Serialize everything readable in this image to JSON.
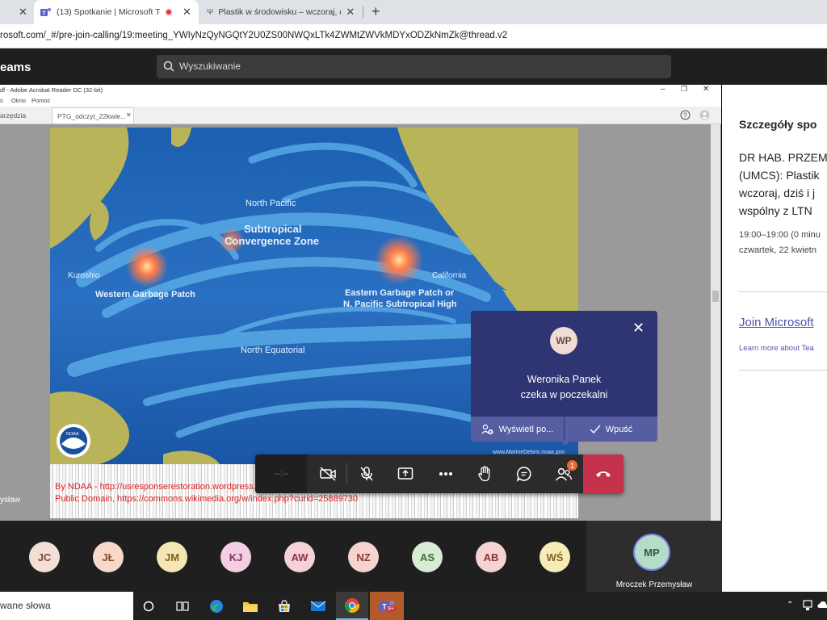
{
  "browser": {
    "tabs": [
      {
        "label": "(13) Spotkanie | Microsoft Te"
      },
      {
        "label": "Plastik w środowisku – wczoraj, d"
      }
    ],
    "address": "rosoft.com/_#/pre-join-calling/19:meeting_YWIyNzQyNGQtY2U0ZS00NWQxLTk4ZWMtZWVkMDYxODZkNmZk@thread.v2"
  },
  "teams": {
    "brand": "eams",
    "search_placeholder": "Wyszukiwanie"
  },
  "acrobat": {
    "title": "df - Adobe Acrobat Reader DC (32-bit)",
    "menu": [
      "Okno",
      "Pomoc"
    ],
    "menu_prefix": "s",
    "tools_tab": "arzędzia",
    "doc_tab": "PTG_odczyt_22kwie..."
  },
  "map": {
    "labels": {
      "north_pacific": "North Pacific",
      "subtropical_1": "Subtropical",
      "subtropical_2": "Convergence Zone",
      "kuroshio": "Kuroshio",
      "western": "Western Garbage Patch",
      "california": "California",
      "eastern_1": "Eastern Garbage Patch or",
      "eastern_2": "N. Pacific Subtropical High",
      "north_equatorial": "North Equatorial",
      "credit": "www.MarineDebris.noaa.gov",
      "noaa": "NOAA"
    },
    "caption": "By NDAA - http://usresponserestoration.wordpress.com/2013/03/07/how-big-is-the-great-pacific-garbage-patch-science-vs-myth/, Public Domain, https://commons.wikimedia.org/w/index.php?curid=25889730"
  },
  "side_name": "ysław",
  "lobby": {
    "initials": "WP",
    "name": "Weronika Panek",
    "status": "czeka w poczekalni",
    "view_label": "Wyświetl po...",
    "admit_label": "Wpuść"
  },
  "controls": {
    "timer": "--:--",
    "participants_badge": "1"
  },
  "participants": [
    {
      "initials": "JC",
      "bg": "#f3dfd6",
      "fg": "#7a4b3d"
    },
    {
      "initials": "JŁ",
      "bg": "#f6d9c8",
      "fg": "#8a4d2c"
    },
    {
      "initials": "JM",
      "bg": "#f7e6b5",
      "fg": "#7a6220"
    },
    {
      "initials": "KJ",
      "bg": "#f4cfe2",
      "fg": "#7d3460"
    },
    {
      "initials": "AW",
      "bg": "#f4d2d8",
      "fg": "#8a3445"
    },
    {
      "initials": "NZ",
      "bg": "#f5d4d0",
      "fg": "#8a3b33"
    },
    {
      "initials": "AS",
      "bg": "#d8ecd3",
      "fg": "#3c6a35"
    },
    {
      "initials": "AB",
      "bg": "#f6d3d3",
      "fg": "#8a3333"
    },
    {
      "initials": "WŚ",
      "bg": "#f7ebb6",
      "fg": "#7a6521"
    }
  ],
  "speaker": {
    "initials": "MP",
    "name": "Mroczek Przemysław"
  },
  "details": {
    "title": "Szczegóły spo",
    "lines": [
      "DR HAB. PRZEM",
      "(UMCS): Plastik",
      "wczoraj, dziś i j",
      "wspólny z LTN"
    ],
    "time": "19:00–19:00 (0 minu",
    "date": "czwartek, 22 kwietn",
    "join": "Join Microsoft",
    "learn": "Learn more about Tea"
  },
  "taskbar": {
    "search_text": "wane słowa",
    "teams_badge": "9+"
  }
}
